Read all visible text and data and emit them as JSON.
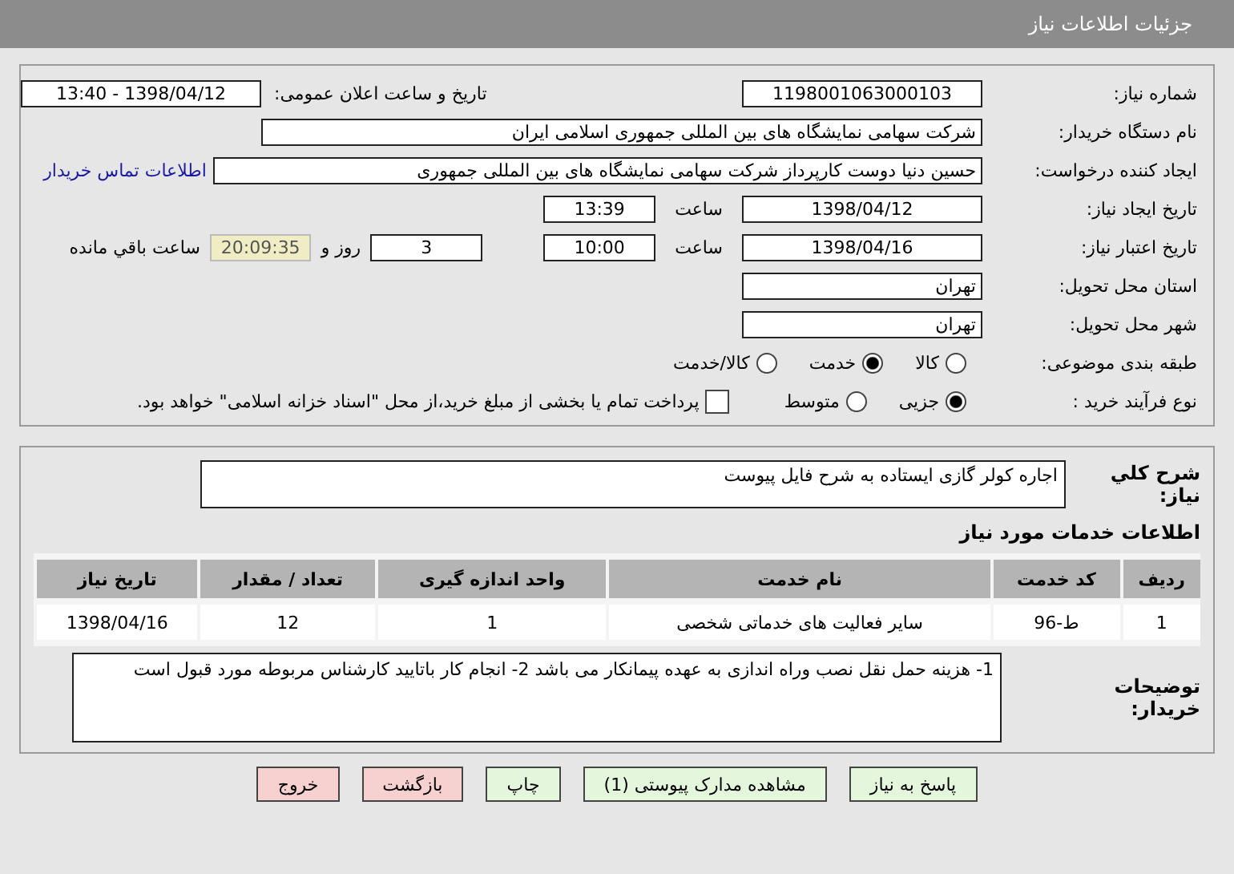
{
  "header": {
    "title": "جزئیات اطلاعات نیاز"
  },
  "need_number": {
    "label": "شماره نیاز:",
    "value": "1198001063000103"
  },
  "announce": {
    "label": "تاریخ و ساعت اعلان عمومی:",
    "value": "1398/04/12 - 13:40"
  },
  "buyer_org": {
    "label": "نام دستگاه خریدار:",
    "value": "شرکت سهامی نمایشگاه های بین المللی جمهوری اسلامی ایران"
  },
  "requester": {
    "label": "ایجاد کننده درخواست:",
    "value": "حسین دنیا دوست کارپرداز شرکت سهامی نمایشگاه های بین المللی جمهوری",
    "link": "اطلاعات تماس خریدار"
  },
  "created": {
    "label": "تاریخ ایجاد نیاز:",
    "date": "1398/04/12",
    "time_label": "ساعت",
    "time": "13:39"
  },
  "validity": {
    "label": "تاریخ اعتبار نیاز:",
    "date": "1398/04/16",
    "time_label": "ساعت",
    "time": "10:00",
    "days": "3",
    "days_label": "روز و",
    "remaining": "20:09:35",
    "remaining_label": "ساعت باقي مانده"
  },
  "province": {
    "label": "استان محل تحویل:",
    "value": "تهران"
  },
  "city": {
    "label": "شهر محل تحویل:",
    "value": "تهران"
  },
  "category": {
    "label": "طبقه بندی موضوعی:",
    "options": [
      {
        "label": "کالا",
        "selected": false
      },
      {
        "label": "خدمت",
        "selected": true
      },
      {
        "label": "کالا/خدمت",
        "selected": false
      }
    ]
  },
  "process": {
    "label": "نوع فرآیند خرید :",
    "options": [
      {
        "label": "جزیی",
        "selected": true
      },
      {
        "label": "متوسط",
        "selected": false
      }
    ],
    "payment_checkbox": {
      "checked": false,
      "label": "پرداخت تمام یا بخشی از مبلغ خرید،از محل \"اسناد خزانه اسلامی\" خواهد بود."
    }
  },
  "description": {
    "label": "شرح کلي نیاز:",
    "value": "اجاره کولر گازی ایستاده به شرح فایل پیوست"
  },
  "services": {
    "title": "اطلاعات خدمات مورد نیاز",
    "columns": [
      "ردیف",
      "کد خدمت",
      "نام خدمت",
      "واحد اندازه گیری",
      "تعداد / مقدار",
      "تاریخ نیاز"
    ],
    "rows": [
      [
        "1",
        "ط-96",
        "سایر فعالیت های خدماتی شخصی",
        "1",
        "12",
        "1398/04/16"
      ]
    ]
  },
  "buyer_notes": {
    "label": "توضیحات خریدار:",
    "value": "1- هزینه حمل نقل نصب وراه اندازی به عهده پیمانکار می باشد 2- انجام کار باتایید کارشناس مربوطه مورد قبول است"
  },
  "buttons": [
    {
      "label": "پاسخ به نیاز",
      "kind": "green"
    },
    {
      "label": "مشاهده مدارک پیوستی (1)",
      "kind": "green"
    },
    {
      "label": "چاپ",
      "kind": "green"
    },
    {
      "label": "بازگشت",
      "kind": "red"
    },
    {
      "label": "خروج",
      "kind": "red"
    }
  ]
}
